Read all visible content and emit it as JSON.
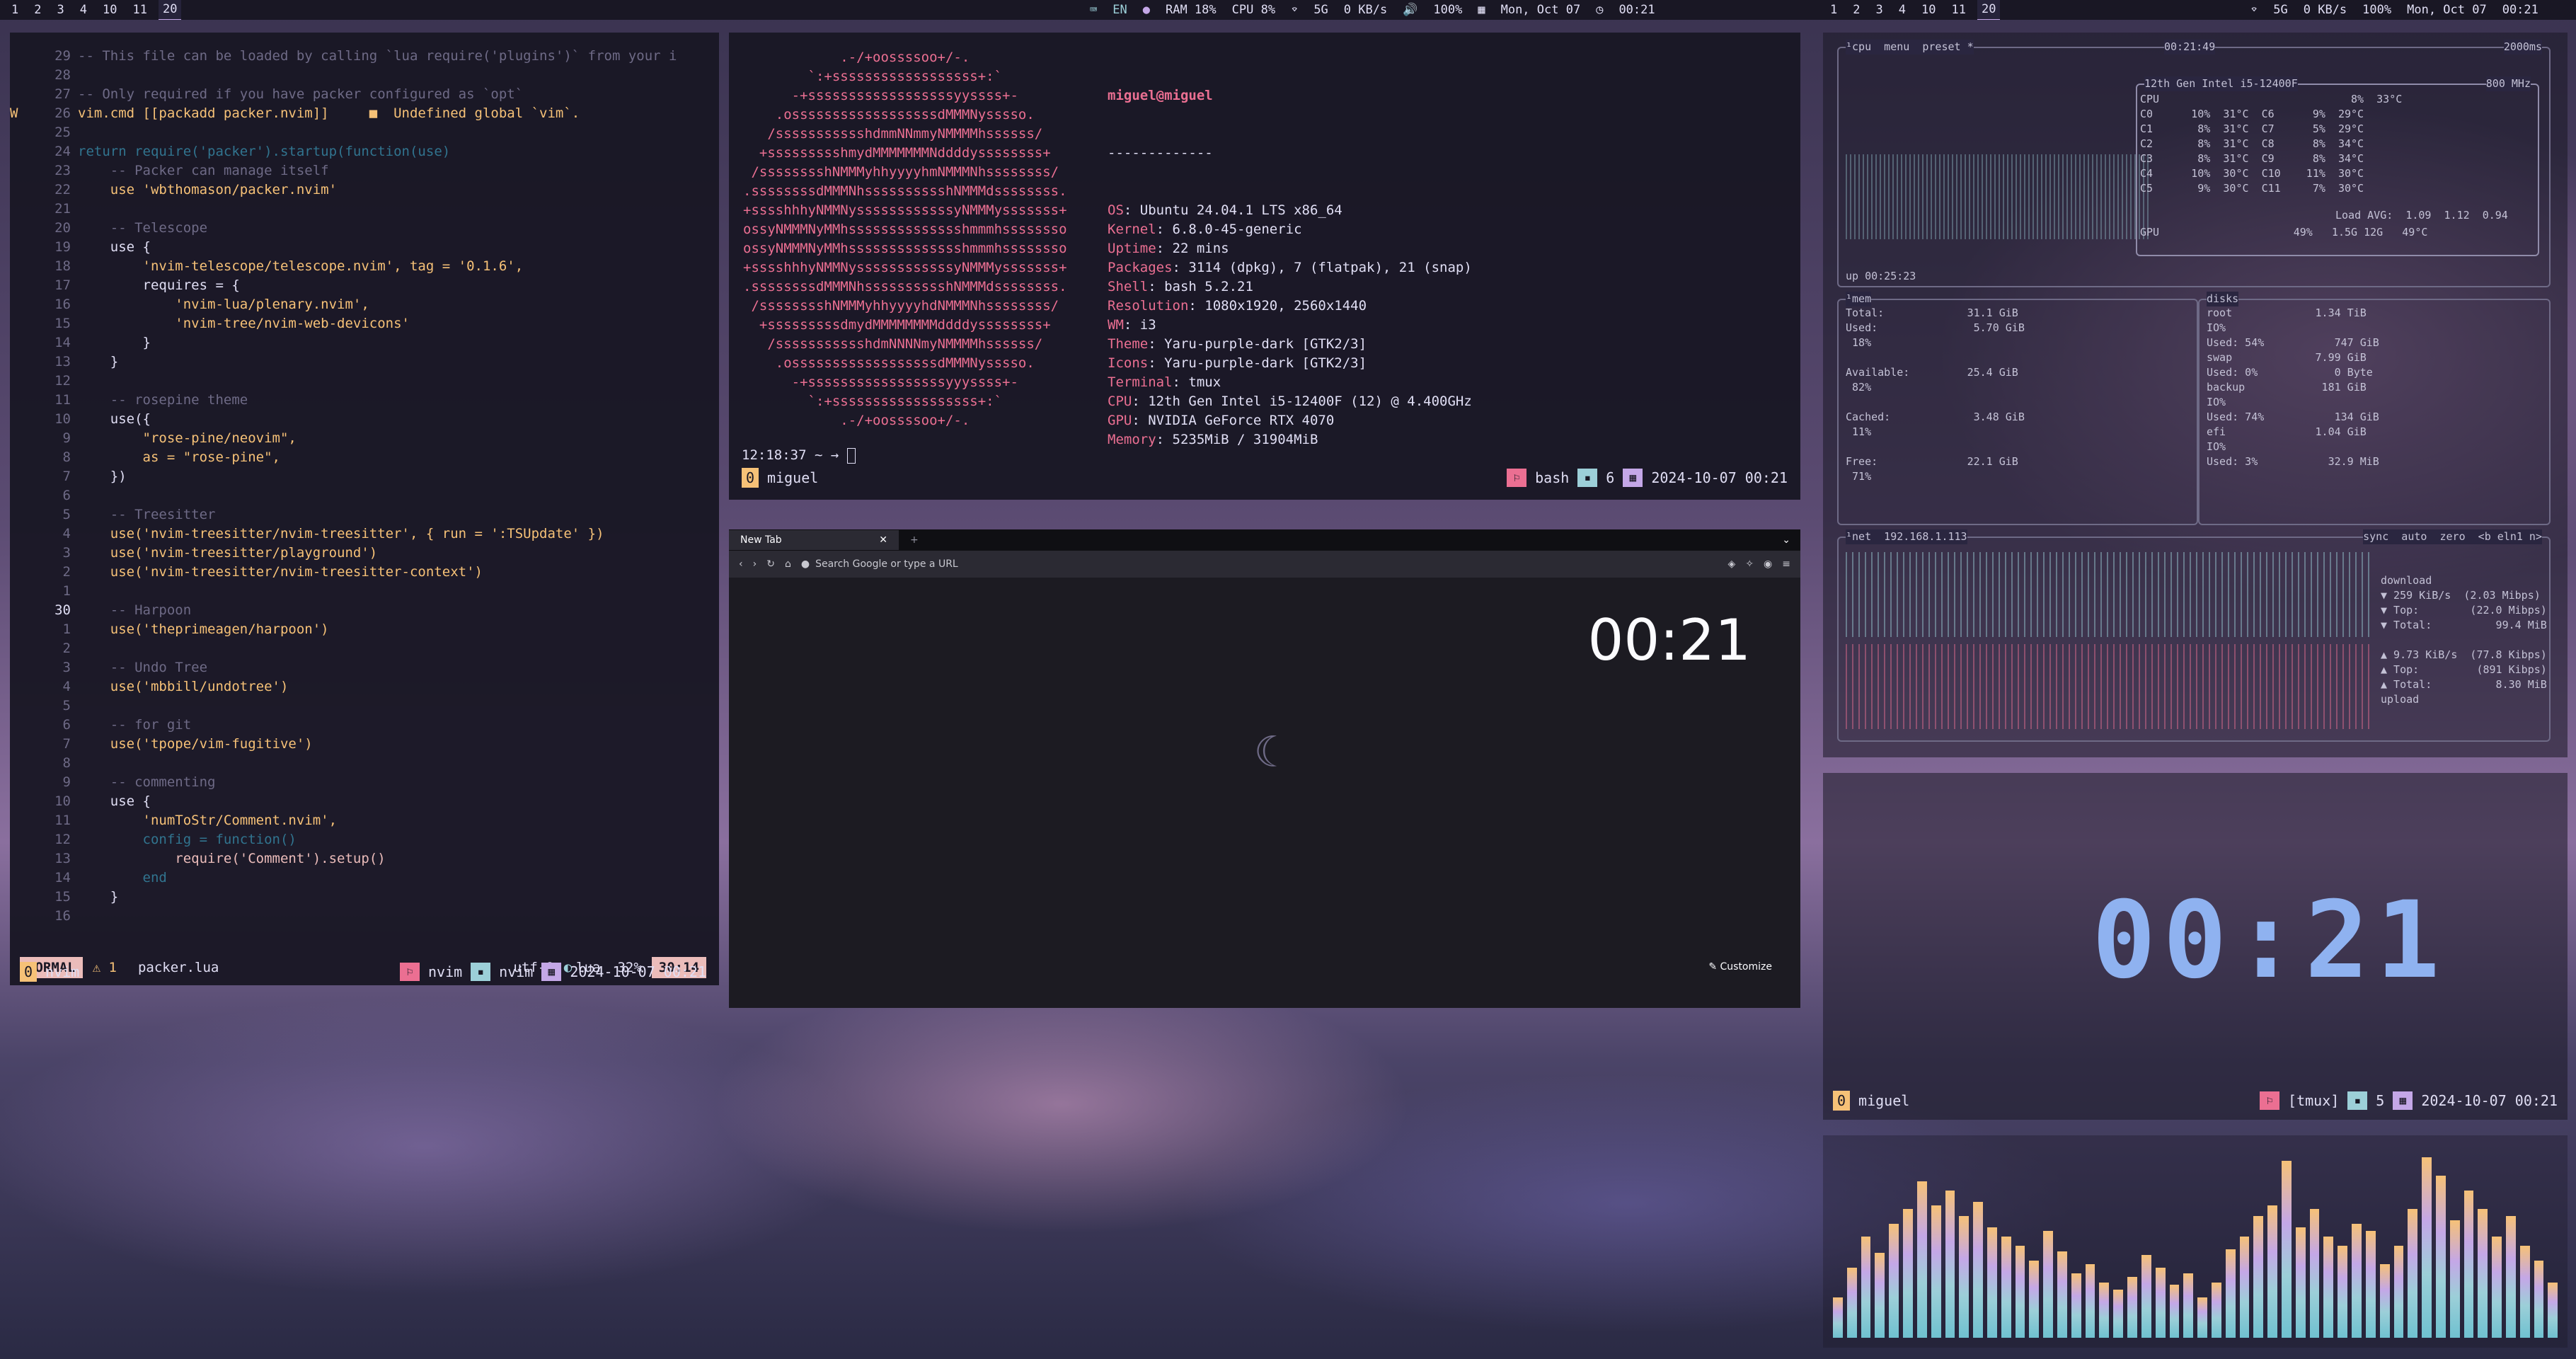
{
  "topbar": {
    "left_workspaces": [
      "1",
      "2",
      "3",
      "4",
      "10",
      "11",
      "20"
    ],
    "left_active": "20",
    "center": {
      "lang": "EN",
      "ram": "RAM 18%",
      "cpu": "CPU  8%",
      "wifi": "5G",
      "net": "0 KB/s",
      "vol": "100%",
      "date": "Mon, Oct 07",
      "time": "00:21"
    },
    "right_workspaces": [
      "1",
      "2",
      "3",
      "4",
      "10",
      "11",
      "20"
    ],
    "right_active": "20",
    "right": {
      "wifi": "5G",
      "net": "0 KB/s",
      "vol": "100%",
      "date": "Mon, Oct 07",
      "time": "00:21"
    }
  },
  "nvim": {
    "lines": [
      {
        "n": "29",
        "t": "-- This file can be loaded by calling `lua require('plugins')` from your i",
        "cls": "c"
      },
      {
        "n": "28",
        "t": "",
        "cls": ""
      },
      {
        "n": "27",
        "t": "-- Only required if you have packer configured as `opt`",
        "cls": "c"
      },
      {
        "n": "26",
        "g": "W",
        "t": "vim.cmd [[packadd packer.nvim]]     ■  Undefined global `vim`.",
        "cls": "s"
      },
      {
        "n": "25",
        "t": "",
        "cls": ""
      },
      {
        "n": "24",
        "t": "return require('packer').startup(function(use)",
        "cls": "k"
      },
      {
        "n": "23",
        "t": "    -- Packer can manage itself",
        "cls": "c"
      },
      {
        "n": "22",
        "t": "    use 'wbthomason/packer.nvim'",
        "cls": "s"
      },
      {
        "n": "21",
        "t": "",
        "cls": ""
      },
      {
        "n": "20",
        "t": "    -- Telescope",
        "cls": "c"
      },
      {
        "n": "19",
        "t": "    use {",
        "cls": ""
      },
      {
        "n": "18",
        "t": "        'nvim-telescope/telescope.nvim', tag = '0.1.6',",
        "cls": "s"
      },
      {
        "n": "17",
        "t": "        requires = {",
        "cls": ""
      },
      {
        "n": "16",
        "t": "            'nvim-lua/plenary.nvim',",
        "cls": "s"
      },
      {
        "n": "15",
        "t": "            'nvim-tree/nvim-web-devicons'",
        "cls": "s"
      },
      {
        "n": "14",
        "t": "        }",
        "cls": ""
      },
      {
        "n": "13",
        "t": "    }",
        "cls": ""
      },
      {
        "n": "12",
        "t": "",
        "cls": ""
      },
      {
        "n": "11",
        "t": "    -- rosepine theme",
        "cls": "c"
      },
      {
        "n": "10",
        "t": "    use({",
        "cls": ""
      },
      {
        "n": "9",
        "t": "        \"rose-pine/neovim\",",
        "cls": "s"
      },
      {
        "n": "8",
        "t": "        as = \"rose-pine\",",
        "cls": "s"
      },
      {
        "n": "7",
        "t": "    })",
        "cls": ""
      },
      {
        "n": "6",
        "t": "",
        "cls": ""
      },
      {
        "n": "5",
        "t": "    -- Treesitter",
        "cls": "c"
      },
      {
        "n": "4",
        "t": "    use('nvim-treesitter/nvim-treesitter', { run = ':TSUpdate' })",
        "cls": "s"
      },
      {
        "n": "3",
        "t": "    use('nvim-treesitter/playground')",
        "cls": "s"
      },
      {
        "n": "2",
        "t": "    use('nvim-treesitter/nvim-treesitter-context')",
        "cls": "s"
      },
      {
        "n": "1",
        "t": "",
        "cls": ""
      },
      {
        "n": "30",
        "t": "    -- Harpoon",
        "cls": "c",
        "cur": true
      },
      {
        "n": "1",
        "t": "    use('theprimeagen/harpoon')",
        "cls": "s"
      },
      {
        "n": "2",
        "t": "",
        "cls": ""
      },
      {
        "n": "3",
        "t": "    -- Undo Tree",
        "cls": "c"
      },
      {
        "n": "4",
        "t": "    use('mbbill/undotree')",
        "cls": "s"
      },
      {
        "n": "5",
        "t": "",
        "cls": ""
      },
      {
        "n": "6",
        "t": "    -- for git",
        "cls": "c"
      },
      {
        "n": "7",
        "t": "    use('tpope/vim-fugitive')",
        "cls": "s"
      },
      {
        "n": "8",
        "t": "",
        "cls": ""
      },
      {
        "n": "9",
        "t": "    -- commenting",
        "cls": "c"
      },
      {
        "n": "10",
        "t": "    use {",
        "cls": ""
      },
      {
        "n": "11",
        "t": "        'numToStr/Comment.nvim',",
        "cls": "s"
      },
      {
        "n": "12",
        "t": "        config = function()",
        "cls": "k"
      },
      {
        "n": "13",
        "t": "            require('Comment').setup()",
        "cls": "f"
      },
      {
        "n": "14",
        "t": "        end",
        "cls": "k"
      },
      {
        "n": "15",
        "t": "    }",
        "cls": ""
      },
      {
        "n": "16",
        "t": "",
        "cls": ""
      }
    ],
    "status": {
      "mode": "NORMAL",
      "warn": "⚠ 1",
      "file": "packer.lua",
      "enc": "utf-8",
      "ft": "lua",
      "pct": "32%",
      "pos": "30:14"
    },
    "tmux": {
      "idx": "0",
      "name": "nvim",
      "w1": "nvim",
      "w2": "nvim",
      "date": "2024-10-07 00:21"
    }
  },
  "neofetch": {
    "logo": [
      "            .-/+oossssoo+/-.",
      "        `:+ssssssssssssssssss+:`",
      "      -+ssssssssssssssssssyyssss+-",
      "    .ossssssssssssssssssdMMMNysssso.",
      "   /ssssssssssshdmmNNmmyNMMMMhssssss/",
      "  +ssssssssshmydMMMMMMMNddddyssssssss+",
      " /sssssssshNMMMyhhyyyyhmNMMMNhssssssss/",
      ".ssssssssdMMMNhsssssssssshNMMMdssssssss.",
      "+sssshhhyNMMNyssssssssssssyNMMMysssssss+",
      "ossyNMMMNyMMhsssssssssssssshmmmhssssssso",
      "ossyNMMMNyMMhsssssssssssssshmmmhssssssso",
      "+sssshhhyNMMNyssssssssssssyNMMMysssssss+",
      ".ssssssssdMMMNhsssssssssshNMMMdssssssss.",
      " /sssssssshNMMMyhhyyyyhdNMMMNhssssssss/",
      "  +sssssssssdmydMMMMMMMMddddyssssssss+",
      "   /ssssssssssshdmNNNNmyNMMMMhssssss/",
      "    .ossssssssssssssssssdMMMNysssso.",
      "      -+sssssssssssssssssyyyssss+-",
      "        `:+ssssssssssssssssss+:`",
      "            .-/+oossssoo+/-."
    ],
    "user": "miguel@miguel",
    "sep": "-------------",
    "fields": [
      {
        "k": "OS",
        "v": "Ubuntu 24.04.1 LTS x86_64"
      },
      {
        "k": "Kernel",
        "v": "6.8.0-45-generic"
      },
      {
        "k": "Uptime",
        "v": "22 mins"
      },
      {
        "k": "Packages",
        "v": "3114 (dpkg), 7 (flatpak), 21 (snap)"
      },
      {
        "k": "Shell",
        "v": "bash 5.2.21"
      },
      {
        "k": "Resolution",
        "v": "1080x1920, 2560x1440"
      },
      {
        "k": "WM",
        "v": "i3"
      },
      {
        "k": "Theme",
        "v": "Yaru-purple-dark [GTK2/3]"
      },
      {
        "k": "Icons",
        "v": "Yaru-purple-dark [GTK2/3]"
      },
      {
        "k": "Terminal",
        "v": "tmux"
      },
      {
        "k": "CPU",
        "v": "12th Gen Intel i5-12400F (12) @ 4.400GHz"
      },
      {
        "k": "GPU",
        "v": "NVIDIA GeForce RTX 4070"
      },
      {
        "k": "Memory",
        "v": "5235MiB / 31904MiB"
      }
    ],
    "colors": [
      "#26233a",
      "#eb6f92",
      "#31748f",
      "#f6c177",
      "#9ccfd8",
      "#c4a7e7",
      "#ebbcba",
      "#e0def4"
    ],
    "prompt": "12:18:37  ~ →",
    "tmux": {
      "idx": "0",
      "name": "miguel",
      "w1": "bash",
      "w2": "6",
      "date": "2024-10-07 00:21"
    }
  },
  "browser": {
    "tab": "New Tab",
    "url_placeholder": "Search Google or type a URL",
    "clock": "00:21",
    "customize": "Customize"
  },
  "btop": {
    "cpu_header": "¹cpu  menu  preset *",
    "time": "00:21:49",
    "ms": "2000ms",
    "cpu_model": "12th Gen Intel i5-12400F",
    "mhz": "800 MHz",
    "cpu_lines": [
      "CPU                              8%  33°C",
      "C0      10%  31°C  C6      9%  29°C",
      "C1       8%  31°C  C7      5%  29°C",
      "C2       8%  31°C  C8      8%  34°C",
      "C3       8%  31°C  C9      8%  34°C",
      "C4      10%  30°C  C10    11%  30°C",
      "C5       9%  30°C  C11     7%  30°C"
    ],
    "load": "Load AVG:  1.09  1.12  0.94",
    "gpu_line": "GPU                     49%   1.5G 12G   49°C",
    "uptime": "up 00:25:23",
    "mem_lines": [
      "Total:             31.1 GiB",
      "Used:               5.70 GiB",
      " 18%",
      "",
      "Available:         25.4 GiB",
      " 82%",
      "",
      "Cached:             3.48 GiB",
      " 11%",
      "",
      "Free:              22.1 GiB",
      " 71%"
    ],
    "disk_lines": [
      "root             1.34 TiB",
      "IO%",
      "Used: 54%           747 GiB",
      "swap             7.99 GiB",
      "Used: 0%            0 Byte",
      "backup            181 GiB",
      "IO%",
      "Used: 74%           134 GiB",
      "efi              1.04 GiB",
      "IO%",
      "Used: 3%           32.9 MiB"
    ],
    "net_header": "¹net  192.168.1.113",
    "net_right": "sync  auto  zero  <b eln1 n>",
    "net_lines": [
      "download",
      "▼ 259 KiB/s  (2.03 Mibps)",
      "▼ Top:        (22.0 Mibps)",
      "▼ Total:          99.4 MiB",
      "",
      "▲ 9.73 KiB/s  (77.8 Kibps)",
      "▲ Top:         (891 Kibps)",
      "▲ Total:          8.30 MiB",
      "upload"
    ]
  },
  "clockterm": {
    "time": "00:21",
    "tmux": {
      "idx": "0",
      "name": "miguel",
      "w1": "[tmux]",
      "w2": "5",
      "date": "2024-10-07 00:21"
    }
  },
  "cava": {
    "values": [
      0.22,
      0.38,
      0.55,
      0.46,
      0.62,
      0.7,
      0.85,
      0.72,
      0.8,
      0.66,
      0.74,
      0.6,
      0.55,
      0.5,
      0.42,
      0.58,
      0.47,
      0.35,
      0.4,
      0.3,
      0.26,
      0.33,
      0.45,
      0.38,
      0.29,
      0.35,
      0.22,
      0.3,
      0.48,
      0.55,
      0.66,
      0.72,
      0.96,
      0.6,
      0.7,
      0.55,
      0.5,
      0.62,
      0.58,
      0.4,
      0.5,
      0.7,
      0.98,
      0.88,
      0.64,
      0.8,
      0.7,
      0.55,
      0.66,
      0.5,
      0.42,
      0.3
    ]
  }
}
